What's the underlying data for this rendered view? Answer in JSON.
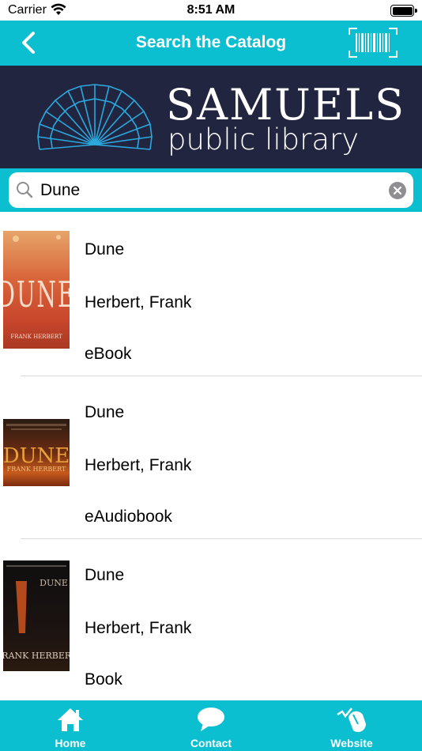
{
  "status_bar": {
    "carrier": "Carrier",
    "time": "8:51 AM"
  },
  "nav": {
    "title": "Search the Catalog"
  },
  "banner": {
    "title": "SAMUELS",
    "subtitle": "public library"
  },
  "search": {
    "query": "Dune"
  },
  "results": [
    {
      "title": "Dune",
      "author": "Herbert, Frank",
      "format": "eBook",
      "cover_text": "DUNE",
      "cover_author": "FRANK HERBERT"
    },
    {
      "title": "Dune",
      "author": "Herbert, Frank",
      "format": "eAudiobook",
      "cover_text": "DUNE",
      "cover_author": "FRANK HERBERT"
    },
    {
      "title": "Dune",
      "author": "Herbert, Frank",
      "format": "Book",
      "cover_text": "DUNE",
      "cover_author": "FRANK HERBERT"
    }
  ],
  "tabs": [
    {
      "label": "Home",
      "icon": "home-icon"
    },
    {
      "label": "Contact",
      "icon": "chat-bubble-icon"
    },
    {
      "label": "Website",
      "icon": "mouse-pointer-icon"
    }
  ],
  "colors": {
    "accent": "#0bbfd0",
    "banner": "#22253f"
  }
}
